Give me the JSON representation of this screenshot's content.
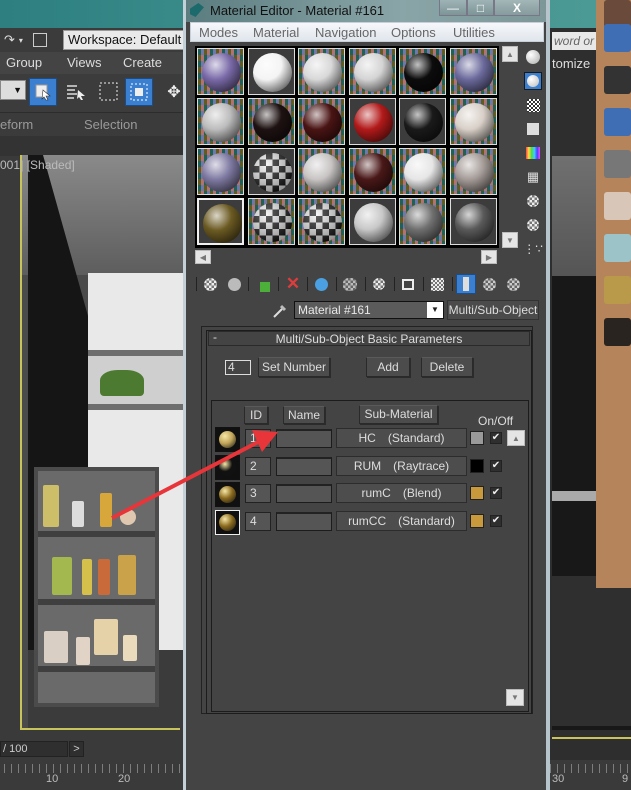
{
  "app": {
    "workspace_label": "Workspace: Default",
    "menu": [
      "Group",
      "Views",
      "Create"
    ],
    "ribbon_tabs": [
      "eform",
      "Selection"
    ],
    "viewport_label": "001] [Shaded]",
    "time_slider": "/ 100",
    "time_next": ">",
    "ruler_labels": [
      "10",
      "20",
      "30",
      "9"
    ],
    "search_placeholder": "word or",
    "customize_label": "tomize"
  },
  "material_editor": {
    "title": "Material Editor - Material #161",
    "window_controls": {
      "minimize": "—",
      "maximize": "□",
      "close": "X"
    },
    "menu": [
      "Modes",
      "Material",
      "Navigation",
      "Options",
      "Utilities"
    ],
    "sample_slots": [
      {
        "kind": "checker-env",
        "color": "#7a6aa8",
        "active": false
      },
      {
        "kind": "gray-bg",
        "color": "#f4f4f4",
        "active": false
      },
      {
        "kind": "checker-env",
        "color": "#d8d8d8",
        "active": false
      },
      {
        "kind": "checker-env",
        "color": "#d4d4d4",
        "active": false
      },
      {
        "kind": "checker-env",
        "color": "#0c0c0c",
        "active": false
      },
      {
        "kind": "checker-env",
        "color": "#6b6a9c",
        "active": false
      },
      {
        "kind": "checker-env",
        "color": "#bcbcbc",
        "active": false
      },
      {
        "kind": "checker-env",
        "color": "#1e1212",
        "active": false
      },
      {
        "kind": "checker-env",
        "color": "#4a1414",
        "active": false
      },
      {
        "kind": "gray-bg",
        "color": "#b31a1a",
        "active": false
      },
      {
        "kind": "gray-bg",
        "color": "#1a1a1a",
        "active": false
      },
      {
        "kind": "checker-env",
        "color": "#d8d0c8",
        "active": false
      },
      {
        "kind": "checker-env",
        "color": "#7f7aa2",
        "active": false
      },
      {
        "kind": "gray-bg",
        "color": "checker",
        "active": false
      },
      {
        "kind": "checker-env",
        "color": "#c8c4c4",
        "active": false
      },
      {
        "kind": "checker-env",
        "color": "#4a1818",
        "active": false
      },
      {
        "kind": "checker-env",
        "color": "#e6e6e6",
        "active": false
      },
      {
        "kind": "checker-env",
        "color": "#a59c98",
        "active": false
      },
      {
        "kind": "gray-bg",
        "color": "#6b5a22",
        "active": true
      },
      {
        "kind": "checker-env",
        "color": "checker",
        "active": false
      },
      {
        "kind": "checker-env",
        "color": "checker",
        "active": false
      },
      {
        "kind": "gray-bg",
        "color": "#c8c8c8",
        "active": false
      },
      {
        "kind": "checker-env",
        "color": "#707070",
        "active": false
      },
      {
        "kind": "gray-bg",
        "color": "#5a5a5a",
        "active": false
      }
    ],
    "side_tools": [
      "sample-type-icon",
      "backlight-icon",
      "background-icon",
      "sample-uv-tiling-icon",
      "video-color-check-icon",
      "make-preview-icon",
      "options-icon",
      "select-by-material-icon",
      "material-map-navigator-icon"
    ],
    "bottom_tools": [
      "get-material-icon",
      "put-to-scene-icon",
      "assign-to-selection-icon",
      "reset-map-icon",
      "make-unique-icon",
      "put-to-library-icon",
      "material-id-channel-icon",
      "show-shaded-in-viewport-icon",
      "show-end-result-icon",
      "go-to-parent-icon",
      "go-forward-sibling-icon"
    ],
    "material_name": "Material #161",
    "material_type": "Multi/Sub-Object",
    "rollout": {
      "collapse": "-",
      "title": "Multi/Sub-Object Basic Parameters",
      "count_value": "4",
      "set_number": "Set Number",
      "add": "Add",
      "delete": "Delete",
      "headers": {
        "id": "ID",
        "name": "Name",
        "sub_material": "Sub-Material",
        "on_off": "On/Off"
      },
      "rows": [
        {
          "id": "1",
          "name": "",
          "sub_material": "HC　(Standard)",
          "swatch": "#9a9a9a",
          "on": true,
          "thumb": "#c2a65a",
          "selected": false
        },
        {
          "id": "2",
          "name": "",
          "sub_material": "RUM　(Raytrace)",
          "swatch": "#000000",
          "on": true,
          "thumb": "#111111",
          "selected": false
        },
        {
          "id": "3",
          "name": "",
          "sub_material": "rumC　(Blend)",
          "swatch": "#c99a3c",
          "on": true,
          "thumb": "#8b6a1e",
          "selected": false
        },
        {
          "id": "4",
          "name": "",
          "sub_material": "rumCC　(Standard)",
          "swatch": "#c99a3c",
          "on": true,
          "thumb": "#8b6a1e",
          "selected": true
        }
      ]
    }
  },
  "colors": {
    "annotation_arrow": "#e8353a",
    "active_tool": "#3a7fd0",
    "viewport_border": "#c8c35a"
  }
}
